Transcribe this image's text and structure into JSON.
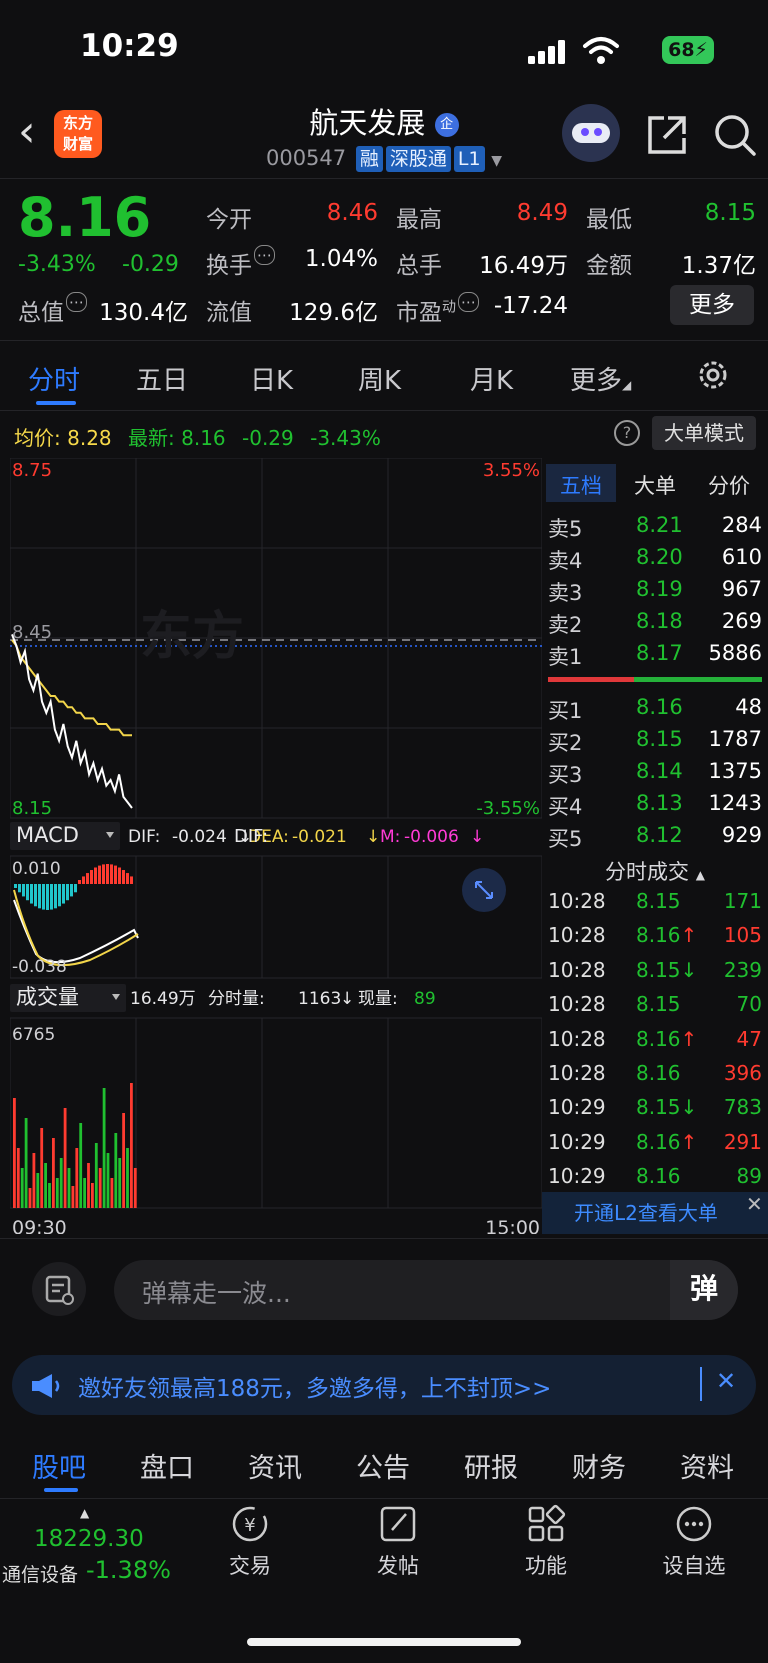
{
  "status": {
    "time": "10:29",
    "battery": "68"
  },
  "header": {
    "logo_line1": "东方",
    "logo_line2": "财富",
    "stock_name": "航天发展",
    "stock_badge": "企",
    "stock_code": "000547",
    "tags": [
      "融",
      "深股通",
      "L1"
    ]
  },
  "quote": {
    "price": "8.16",
    "change_pct": "-3.43%",
    "change_amt": "-0.29",
    "open_label": "今开",
    "open": "8.46",
    "high_label": "最高",
    "high": "8.49",
    "low_label": "最低",
    "low": "8.15",
    "turnover_label": "换手",
    "turnover": "1.04%",
    "volume_label": "总手",
    "volume": "16.49万",
    "amount_label": "金额",
    "amount": "1.37亿",
    "mktcap_label": "总值",
    "mktcap": "130.4亿",
    "float_label": "流值",
    "float": "129.6亿",
    "pe_label": "市盈",
    "pe_sup": "动",
    "pe": "-17.24",
    "more": "更多"
  },
  "chart_tabs": [
    "分时",
    "五日",
    "日K",
    "周K",
    "月K",
    "更多"
  ],
  "info_row": {
    "avg_label": "均价:",
    "avg": "8.28",
    "latest_label": "最新:",
    "latest": "8.16",
    "chg": "-0.29",
    "pct": "-3.43%",
    "help": "?",
    "bigorder": "大单模式"
  },
  "chart_data": {
    "type": "line",
    "title": "",
    "price_axis": {
      "top": "8.75",
      "mid": "8.45",
      "bottom": "8.15",
      "top_pct": "3.55%",
      "bottom_pct": "-3.55%"
    },
    "time_axis": {
      "start": "09:30",
      "end": "15:00"
    },
    "ylim": [
      8.15,
      8.75
    ],
    "prev_close": 8.45,
    "series": [],
    "price_points": [
      8.46,
      8.44,
      8.41,
      8.43,
      8.38,
      8.36,
      8.39,
      8.34,
      8.32,
      8.34,
      8.29,
      8.27,
      8.3,
      8.26,
      8.24,
      8.27,
      8.23,
      8.25,
      8.21,
      8.23,
      8.2,
      8.22,
      8.19,
      8.2,
      8.18,
      8.21,
      8.17,
      8.16,
      8.15
    ],
    "avg_points": [
      8.45,
      8.44,
      8.42,
      8.41,
      8.4,
      8.39,
      8.38,
      8.37,
      8.36,
      8.35,
      8.35,
      8.34,
      8.34,
      8.33,
      8.33,
      8.32,
      8.32,
      8.31,
      8.31,
      8.31,
      8.3,
      8.3,
      8.3,
      8.29,
      8.29,
      8.29,
      8.28,
      8.28,
      8.28
    ],
    "macd": {
      "label": "MACD",
      "dif_label": "DIF:",
      "dif": "-0.024",
      "dea_label": "DEA:",
      "dea": "-0.021",
      "m_label": "M:",
      "m": "-0.006",
      "top": "0.010",
      "bottom": "-0.038"
    },
    "volume": {
      "label": "成交量",
      "total": "16.49万",
      "minute_label": "分时量:",
      "minute": "1163",
      "now_label": "现量:",
      "now": "89",
      "max": "6765"
    }
  },
  "order_book": {
    "tabs": [
      "五档",
      "大单",
      "分价"
    ],
    "sells": [
      {
        "label": "卖5",
        "price": "8.21",
        "vol": "284"
      },
      {
        "label": "卖4",
        "price": "8.20",
        "vol": "610"
      },
      {
        "label": "卖3",
        "price": "8.19",
        "vol": "967"
      },
      {
        "label": "卖2",
        "price": "8.18",
        "vol": "269"
      },
      {
        "label": "卖1",
        "price": "8.17",
        "vol": "5886"
      }
    ],
    "buys": [
      {
        "label": "买1",
        "price": "8.16",
        "vol": "48"
      },
      {
        "label": "买2",
        "price": "8.15",
        "vol": "1787"
      },
      {
        "label": "买3",
        "price": "8.14",
        "vol": "1375"
      },
      {
        "label": "买4",
        "price": "8.13",
        "vol": "1243"
      },
      {
        "label": "买5",
        "price": "8.12",
        "vol": "929"
      }
    ],
    "trades_title": "分时成交",
    "trades": [
      {
        "time": "10:28",
        "price": "8.15",
        "arrow": "",
        "vol": "171",
        "color": "green"
      },
      {
        "time": "10:28",
        "price": "8.16",
        "arrow": "↑",
        "vol": "105",
        "color": "red"
      },
      {
        "time": "10:28",
        "price": "8.15",
        "arrow": "↓",
        "vol": "239",
        "color": "green"
      },
      {
        "time": "10:28",
        "price": "8.15",
        "arrow": "",
        "vol": "70",
        "color": "green"
      },
      {
        "time": "10:28",
        "price": "8.16",
        "arrow": "↑",
        "vol": "47",
        "color": "red"
      },
      {
        "time": "10:28",
        "price": "8.16",
        "arrow": "",
        "vol": "396",
        "color": "red"
      },
      {
        "time": "10:29",
        "price": "8.15",
        "arrow": "↓",
        "vol": "783",
        "color": "green"
      },
      {
        "time": "10:29",
        "price": "8.16",
        "arrow": "↑",
        "vol": "291",
        "color": "red"
      },
      {
        "time": "10:29",
        "price": "8.16",
        "arrow": "",
        "vol": "89",
        "color": "green"
      }
    ],
    "l2_banner": "开通L2查看大单"
  },
  "danmaku": {
    "placeholder": "弹幕走一波...",
    "send": "弹"
  },
  "promo": {
    "text": "邀好友领最高188元，多邀多得，上不封顶>>"
  },
  "bottom_tabs": [
    "股吧",
    "盘口",
    "资讯",
    "公告",
    "研报",
    "财务",
    "资料"
  ],
  "toolbar": {
    "index_value": "18229.30",
    "index_name": "通信设备",
    "index_pct": "-1.38%",
    "trade": "交易",
    "post": "发帖",
    "functions": "功能",
    "watchlist": "设自选"
  }
}
